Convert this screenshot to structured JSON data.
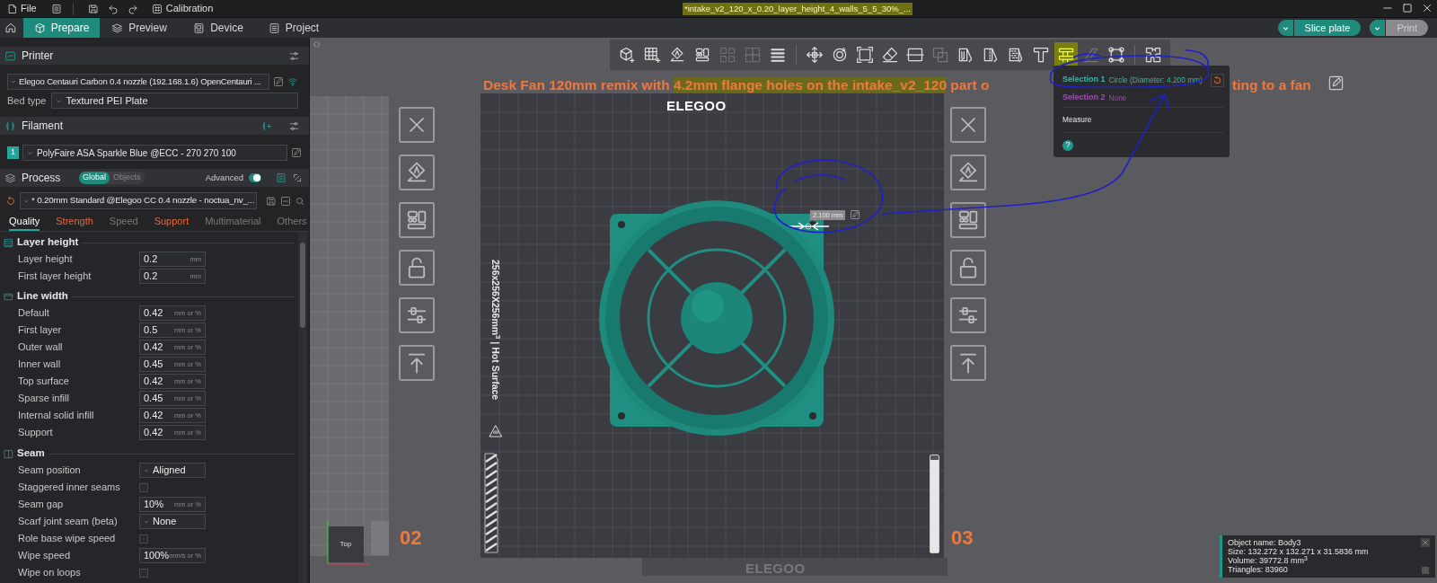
{
  "title_bar": {
    "file": "File",
    "calibration": "Calibration",
    "document_title": "*intake_v2_120_x_0.20_layer_height_4_walls_5_5_30%_...",
    "title_highlighted": true
  },
  "tabs": [
    {
      "label": "Prepare",
      "selected": true
    },
    {
      "label": "Preview",
      "selected": false
    },
    {
      "label": "Device",
      "selected": false
    },
    {
      "label": "Project",
      "selected": false
    }
  ],
  "actions": [
    {
      "label": "Slice plate",
      "disabled": false
    },
    {
      "label": "Print",
      "disabled": true
    }
  ],
  "printer": {
    "header": "Printer",
    "preset": "Elegoo Centauri Carbon 0.4 nozzle (192.168.1.6) OpenCentauri ...",
    "connected": true,
    "bed_type_label": "Bed type",
    "bed_type": "Textured PEI Plate"
  },
  "filament": {
    "header": "Filament",
    "slots": [
      {
        "index": "1",
        "color": "#26a69a",
        "preset": "PolyFaire ASA Sparkle Blue @ECC - 270 270 100"
      }
    ]
  },
  "process": {
    "header": "Process",
    "scope": [
      {
        "label": "Global",
        "selected": true
      },
      {
        "label": "Objects",
        "selected": false
      }
    ],
    "advanced_label": "Advanced",
    "advanced_on": true,
    "preset": "* 0.20mm Standard @Elegoo CC 0.4 nozzle - noctua_nv_...",
    "modified": true,
    "tabs": [
      {
        "label": "Quality",
        "selected": true,
        "modified": false,
        "disabled": false
      },
      {
        "label": "Strength",
        "selected": false,
        "modified": true,
        "disabled": false
      },
      {
        "label": "Speed",
        "selected": false,
        "modified": false,
        "disabled": true
      },
      {
        "label": "Support",
        "selected": false,
        "modified": true,
        "disabled": false
      },
      {
        "label": "Multimaterial",
        "selected": false,
        "modified": false,
        "disabled": true
      },
      {
        "label": "Others",
        "selected": false,
        "modified": false,
        "disabled": true
      }
    ]
  },
  "settings": [
    {
      "title": "Layer height",
      "rows": [
        {
          "kind": "input",
          "label": "Layer height",
          "value": "0.2",
          "unit": "mm"
        },
        {
          "kind": "input",
          "label": "First layer height",
          "value": "0.2",
          "unit": "mm"
        }
      ]
    },
    {
      "title": "Line width",
      "rows": [
        {
          "kind": "input",
          "label": "Default",
          "value": "0.42",
          "unit": "mm or %"
        },
        {
          "kind": "input",
          "label": "First layer",
          "value": "0.5",
          "unit": "mm or %"
        },
        {
          "kind": "input",
          "label": "Outer wall",
          "value": "0.42",
          "unit": "mm or %"
        },
        {
          "kind": "input",
          "label": "Inner wall",
          "value": "0.45",
          "unit": "mm or %"
        },
        {
          "kind": "input",
          "label": "Top surface",
          "value": "0.42",
          "unit": "mm or %"
        },
        {
          "kind": "input",
          "label": "Sparse infill",
          "value": "0.45",
          "unit": "mm or %"
        },
        {
          "kind": "input",
          "label": "Internal solid infill",
          "value": "0.42",
          "unit": "mm or %"
        },
        {
          "kind": "input",
          "label": "Support",
          "value": "0.42",
          "unit": "mm or %"
        }
      ]
    },
    {
      "title": "Seam",
      "rows": [
        {
          "kind": "select",
          "label": "Seam position",
          "value": "Aligned"
        },
        {
          "kind": "checkbox",
          "label": "Staggered inner seams",
          "checked": false
        },
        {
          "kind": "input",
          "label": "Seam gap",
          "value": "10%",
          "unit": "mm or %"
        },
        {
          "kind": "select",
          "label": "Scarf joint seam (beta)",
          "value": "None"
        },
        {
          "kind": "checkbox",
          "label": "Role base wipe speed",
          "checked": false
        },
        {
          "kind": "input",
          "label": "Wipe speed",
          "value": "100%",
          "unit": "mm/s or %"
        },
        {
          "kind": "checkbox",
          "label": "Wipe on loops",
          "checked": false
        }
      ]
    }
  ],
  "toolbar": [
    [
      {
        "kind": "add-cube",
        "selected": false,
        "disabled": false
      },
      {
        "kind": "add-plate",
        "selected": false,
        "disabled": false
      },
      {
        "kind": "orient",
        "selected": false,
        "disabled": false
      },
      {
        "kind": "arrange",
        "selected": false,
        "disabled": false
      },
      {
        "kind": "split-objects",
        "selected": false,
        "disabled": true
      },
      {
        "kind": "split-parts",
        "selected": false,
        "disabled": true
      },
      {
        "kind": "layers",
        "selected": false,
        "disabled": false
      }
    ],
    [
      {
        "kind": "move",
        "selected": false,
        "disabled": false
      },
      {
        "kind": "rotate",
        "selected": false,
        "disabled": false
      },
      {
        "kind": "scale",
        "selected": false,
        "disabled": false
      },
      {
        "kind": "flatten",
        "selected": false,
        "disabled": false
      },
      {
        "kind": "cut",
        "selected": false,
        "disabled": false
      },
      {
        "kind": "boolean",
        "selected": false,
        "disabled": true
      },
      {
        "kind": "support-paint",
        "selected": false,
        "disabled": false
      },
      {
        "kind": "seam-paint",
        "selected": false,
        "disabled": false
      },
      {
        "kind": "fuzzy-paint",
        "selected": false,
        "disabled": false
      },
      {
        "kind": "text",
        "selected": false,
        "disabled": false
      },
      {
        "kind": "measure",
        "selected": true,
        "disabled": false
      },
      {
        "kind": "emboss",
        "selected": false,
        "disabled": true
      },
      {
        "kind": "assembly",
        "selected": false,
        "disabled": false
      }
    ],
    [
      {
        "kind": "puzzle",
        "selected": false,
        "disabled": false
      }
    ]
  ],
  "object_title": {
    "segments": [
      {
        "text": "Desk Fan 120mm remix with ",
        "highlighted": false
      },
      {
        "text": "4.2mm flange holes on the intake_v2_120",
        "highlighted": true
      },
      {
        "text": " part o",
        "highlighted": false
      }
    ],
    "tail": "ting to a fan"
  },
  "plates": [
    {
      "number": "02"
    },
    {
      "number": "03"
    }
  ],
  "view_cube": {
    "label": "Top"
  },
  "build_plate": {
    "brand": "ELEGOO",
    "size_note": "256x256X256mm$^{3}$ | Hot Surface",
    "footer_brand": "ELEGOO",
    "measure_label": "2.100 mm"
  },
  "layer_slider": {
    "level": 0.95
  },
  "measure_panel": {
    "rows": [
      {
        "label": "Selection 1",
        "value": "Circle (Diameter: 4.200 mm)",
        "color": "#3fb4a4"
      },
      {
        "label": "Selection 2",
        "value": "None",
        "color": "#9b4fb0"
      }
    ],
    "action": "Measure",
    "help": "?"
  },
  "object_info": {
    "lines": [
      "Object name: Body3",
      "Size: 132.272 x 132.271 x 31.5836 mm",
      "Volume: 39772.8 mm$^{3}$",
      "Triangles: 83960"
    ]
  }
}
